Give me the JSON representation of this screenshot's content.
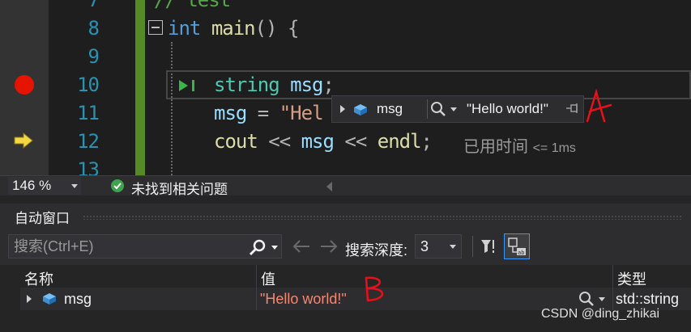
{
  "editor": {
    "line_numbers": [
      "7",
      "8",
      "9",
      "10",
      "11",
      "12",
      "13"
    ],
    "line7_comment": "// test",
    "line8": {
      "kw": "int",
      "fn": "main",
      "rest": "() {"
    },
    "line10": {
      "type": "string",
      "id": "msg",
      "semi": ";"
    },
    "line11": {
      "id": "msg",
      "op": " = ",
      "str": "\"Hel"
    },
    "line12": {
      "fn": "cout",
      "op1": " << ",
      "id": "msg",
      "op2": " << ",
      "fn2": "endl",
      "semi": ";"
    },
    "perf_tip": {
      "label": "已用时间",
      "value": "<= 1ms"
    }
  },
  "datatip": {
    "name": "msg",
    "value": "\"Hello world!\""
  },
  "status": {
    "zoom": "146 %",
    "issues": "未找到相关问题"
  },
  "autos": {
    "title": "自动窗口",
    "search_placeholder": "搜索(Ctrl+E)",
    "depth_label": "搜索深度:",
    "depth_value": "3",
    "columns": {
      "name": "名称",
      "value": "值",
      "type": "类型"
    },
    "rows": [
      {
        "name": "msg",
        "value": "\"Hello world!\"",
        "type": "std::string"
      }
    ]
  },
  "annotations": {
    "a": "A",
    "b": "B"
  },
  "watermark": "CSDN @ding_zhikai",
  "colors": {
    "breakpoint": "#e51400",
    "changed_bar": "#578a27",
    "annotation": "#e8101a",
    "accent": "#3399ff"
  },
  "icons": [
    "breakpoint-icon",
    "current-statement-arrow-icon",
    "collapse-icon",
    "run-to-click-icon",
    "object-cube-icon",
    "search-icon",
    "pin-icon",
    "check-icon",
    "back-arrow-icon",
    "forward-arrow-icon",
    "filter-icon",
    "tab-view-icon"
  ]
}
